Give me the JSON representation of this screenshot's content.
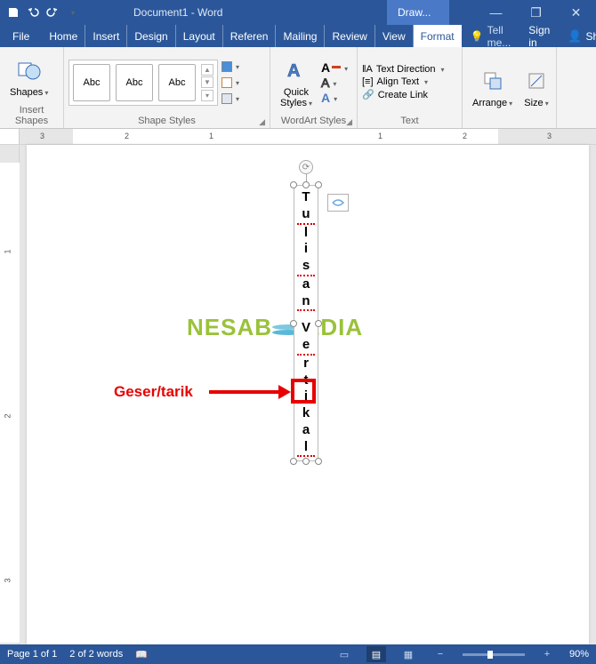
{
  "title": "Document1 - Word",
  "contextual_tab_group": "Draw...",
  "window_buttons": {
    "minimize": "—",
    "restore": "❐",
    "close": "✕"
  },
  "qat": {
    "save": "save-icon",
    "undo": "undo-icon",
    "redo": "redo-icon",
    "customize": "customize-icon"
  },
  "tabs": {
    "file": "File",
    "home": "Home",
    "insert": "Insert",
    "design": "Design",
    "layout": "Layout",
    "references": "Referen",
    "mailings": "Mailing",
    "review": "Review",
    "view": "View",
    "format": "Format"
  },
  "tellme": "Tell me...",
  "signin": "Sign in",
  "share": "Share",
  "ribbon": {
    "insert_shapes": {
      "label": "Insert Shapes",
      "shapes_btn": "Shapes"
    },
    "shape_styles": {
      "label": "Shape Styles",
      "gallery_text": "Abc",
      "shape_fill": "Shape Fill",
      "shape_outline": "Shape Outline",
      "shape_effects": "Shape Effects"
    },
    "wordart_styles": {
      "label": "WordArt Styles",
      "quick_styles": "Quick\nStyles"
    },
    "text": {
      "label": "Text",
      "text_direction": "Text Direction",
      "align_text": "Align Text",
      "create_link": "Create Link"
    },
    "arrange": {
      "label": "Arrange",
      "btn": "Arrange"
    },
    "size": {
      "label": "Size",
      "btn": "Size"
    }
  },
  "document": {
    "textbox_chars": [
      "T",
      "u",
      "l",
      "i",
      "s",
      "a",
      "n",
      "V",
      "e",
      "r",
      "t",
      "i",
      "k",
      "a",
      "l"
    ],
    "spell_indices": [
      1,
      4,
      6,
      8,
      14
    ]
  },
  "annotation": {
    "label": "Geser/tarik"
  },
  "watermark": {
    "left": "NESAB",
    "right": "EDIA"
  },
  "status": {
    "page": "Page 1 of 1",
    "words": "2 of 2 words",
    "zoom": "90%"
  },
  "ruler_h_nums": [
    "3",
    "2",
    "1",
    "1",
    "2",
    "3"
  ],
  "ruler_v_nums": [
    "1",
    "2",
    "3"
  ]
}
